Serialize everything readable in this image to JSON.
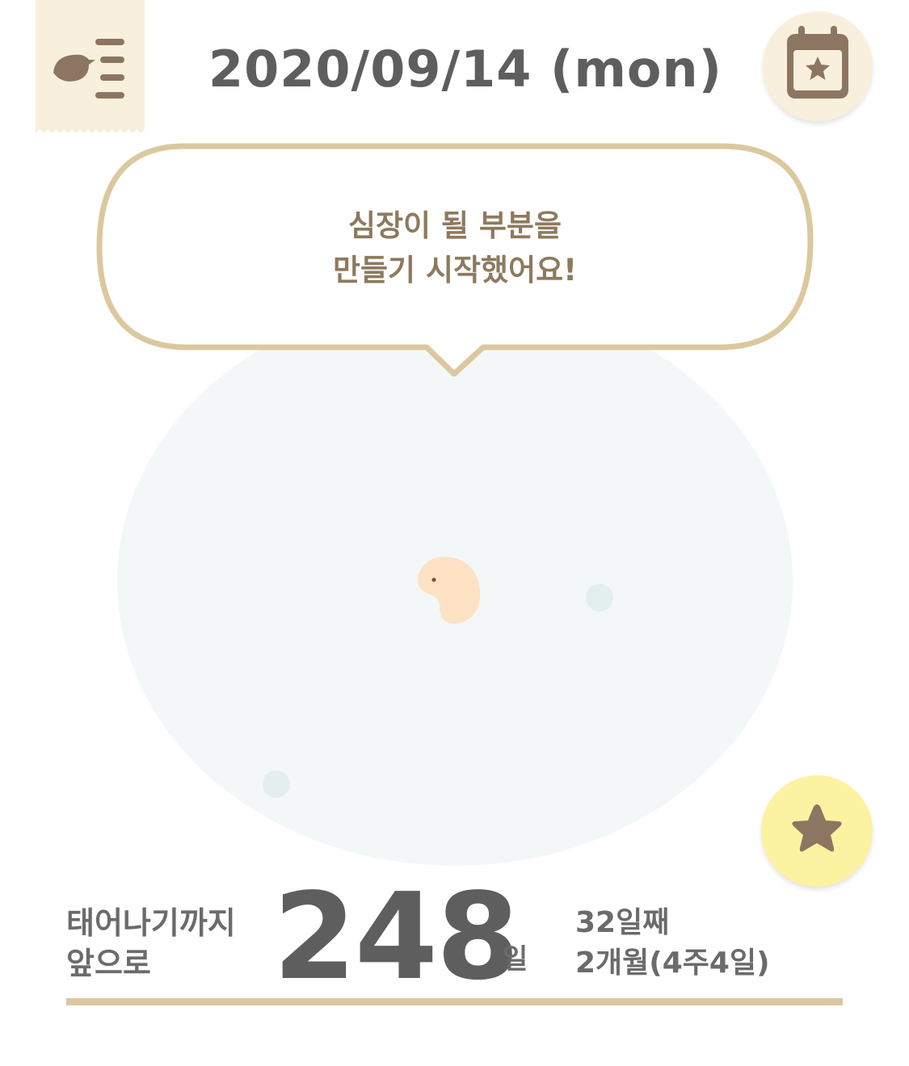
{
  "header": {
    "date": "2020/09/14 (mon)",
    "menu_icon": "bird-menu-icon",
    "calendar_icon": "calendar-star-icon"
  },
  "speech_bubble": {
    "line1": "심장이 될 부분을",
    "line2": "만들기 시작했어요!"
  },
  "countdown": {
    "label_line1": "태어나기까지",
    "label_line2": "앞으로",
    "days_remaining": "248",
    "days_unit": "일",
    "day_count": "32일째",
    "month_week": "2개월(4주4일)"
  },
  "star_button_icon": "star-icon",
  "colors": {
    "cream": "#f8f0dd",
    "brown": "#8c7662",
    "gold_border": "#dcc89f",
    "embryo": "#fde2c3",
    "star_button_bg": "#fbf3a2",
    "circle_bg": "#f3f7f8"
  }
}
